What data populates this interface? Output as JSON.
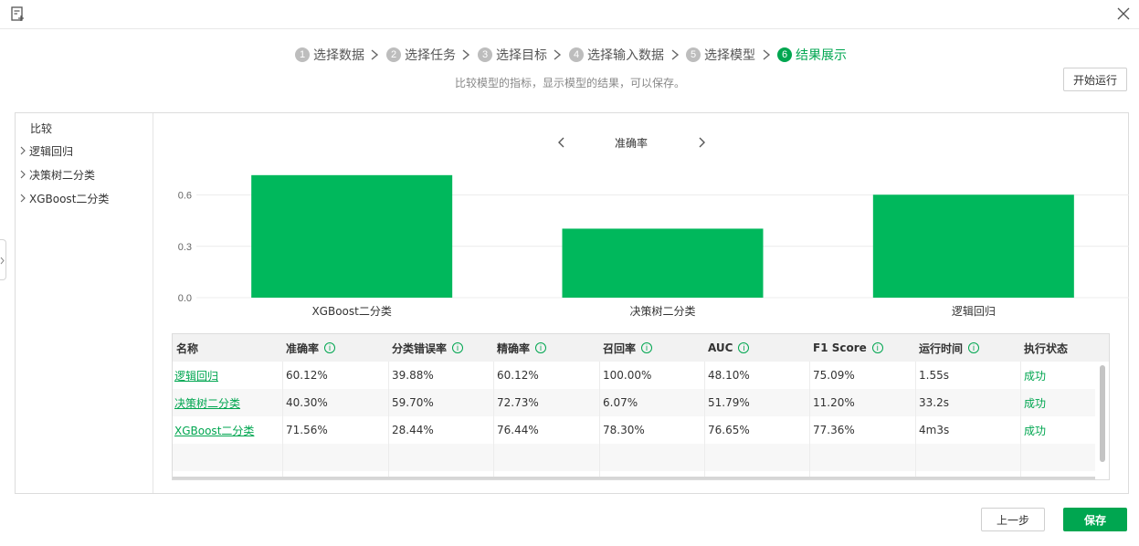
{
  "steps": [
    {
      "num": "1",
      "label": "选择数据"
    },
    {
      "num": "2",
      "label": "选择任务"
    },
    {
      "num": "3",
      "label": "选择目标"
    },
    {
      "num": "4",
      "label": "选择输入数据"
    },
    {
      "num": "5",
      "label": "选择模型"
    },
    {
      "num": "6",
      "label": "结果展示"
    }
  ],
  "subtitle": "比较模型的指标，显示模型的结果，可以保存。",
  "buttons": {
    "run": "开始运行",
    "prev": "上一步",
    "save": "保存"
  },
  "sidebar": {
    "title": "比较",
    "items": [
      "逻辑回归",
      "决策树二分类",
      "XGBoost二分类"
    ]
  },
  "chart_header": {
    "metric": "准确率"
  },
  "chart_data": {
    "type": "bar",
    "categories": [
      "XGBoost二分类",
      "决策树二分类",
      "逻辑回归"
    ],
    "values": [
      0.7156,
      0.403,
      0.6012
    ],
    "ylim": [
      0,
      0.72
    ],
    "yticks": [
      "0.0",
      "0.3",
      "0.6"
    ],
    "ytick_values": [
      0,
      0.3,
      0.6
    ],
    "grid": true,
    "color": "#00b85c"
  },
  "table": {
    "headers": [
      "名称",
      "准确率",
      "分类错误率",
      "精确率",
      "召回率",
      "AUC",
      "F1 Score",
      "运行时间",
      "执行状态"
    ],
    "info_icon": "i",
    "rows": [
      [
        "逻辑回归",
        "60.12%",
        "39.88%",
        "60.12%",
        "100.00%",
        "48.10%",
        "75.09%",
        "1.55s",
        "成功"
      ],
      [
        "决策树二分类",
        "40.30%",
        "59.70%",
        "72.73%",
        "6.07%",
        "51.79%",
        "11.20%",
        "33.2s",
        "成功"
      ],
      [
        "XGBoost二分类",
        "71.56%",
        "28.44%",
        "76.44%",
        "78.30%",
        "76.65%",
        "77.36%",
        "4m3s",
        "成功"
      ]
    ]
  },
  "colors": {
    "accent": "#00a650",
    "bar": "#00b85c"
  }
}
